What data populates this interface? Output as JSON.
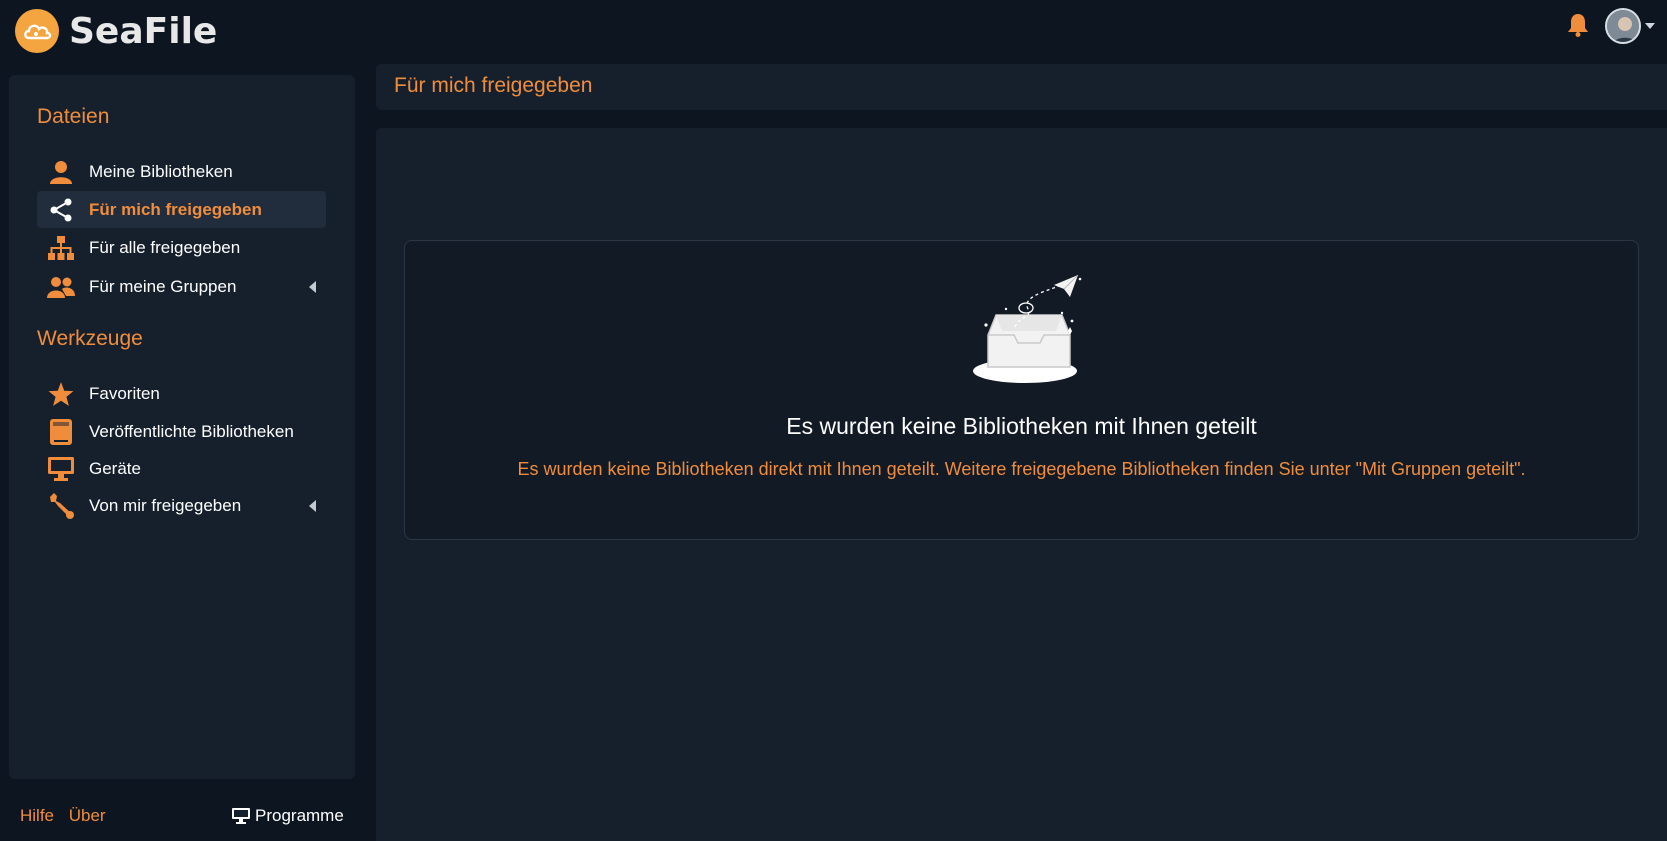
{
  "app": {
    "name": "SeaFile"
  },
  "sidebar": {
    "sections": [
      {
        "title": "Dateien",
        "items": [
          {
            "label": "Meine Bibliotheken",
            "icon": "user-icon",
            "active": false
          },
          {
            "label": "Für mich freigegeben",
            "icon": "share-icon",
            "active": true
          },
          {
            "label": "Für alle freigegeben",
            "icon": "org-chart-icon",
            "active": false
          },
          {
            "label": "Für meine Gruppen",
            "icon": "group-icon",
            "active": false,
            "expandable": true
          }
        ]
      },
      {
        "title": "Werkzeuge",
        "items": [
          {
            "label": "Favoriten",
            "icon": "star-icon",
            "active": false
          },
          {
            "label": "Veröffentlichte Bibliotheken",
            "icon": "book-icon",
            "active": false
          },
          {
            "label": "Geräte",
            "icon": "monitor-icon",
            "active": false
          },
          {
            "label": "Von mir freigegeben",
            "icon": "wrench-icon",
            "active": false,
            "expandable": true
          }
        ]
      }
    ],
    "footer": {
      "help": "Hilfe",
      "about": "Über",
      "clients": "Programme"
    }
  },
  "main": {
    "page_title": "Für mich freigegeben",
    "empty_state": {
      "title": "Es wurden keine Bibliotheken mit Ihnen geteilt",
      "description": "Es wurden keine Bibliotheken direkt mit Ihnen geteilt. Weitere freigegebene Bibliotheken finden Sie unter \"Mit Gruppen geteilt\"."
    }
  },
  "colors": {
    "accent": "#f08d3c",
    "background": "#0d1520",
    "panel": "#16202d",
    "active_item": "#212d3c"
  }
}
